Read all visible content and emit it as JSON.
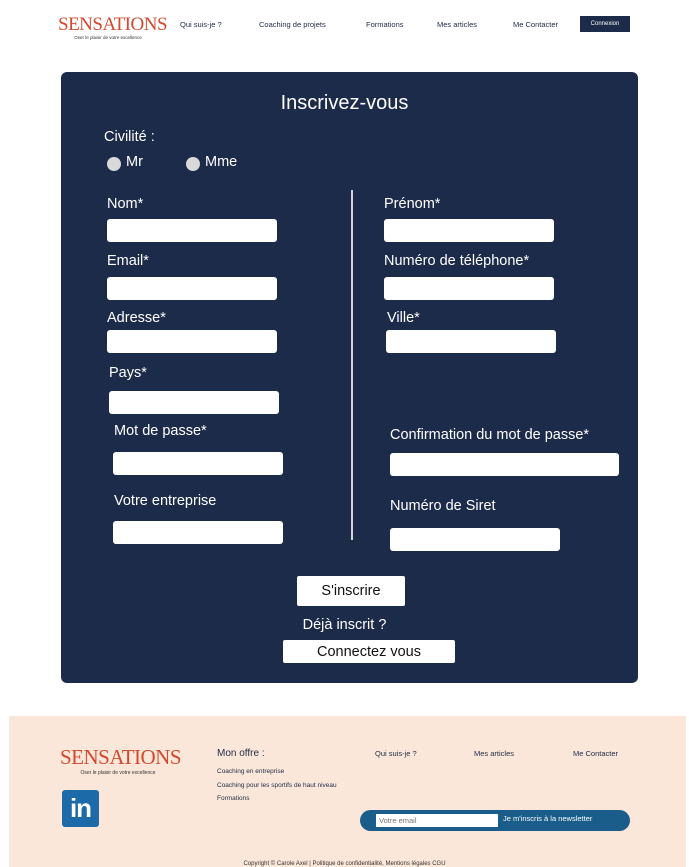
{
  "header": {
    "logo_word": "SENSATIONS",
    "logo_tagline": "Oser le plaisir de votre excellence",
    "nav": [
      "Qui suis-je ?",
      "Coaching de projets",
      "Formations",
      "Mes articles",
      "Me Contacter"
    ],
    "connexion_label": "Connexion"
  },
  "form": {
    "title": "Inscrivez-vous",
    "civility_label": "Civilité :",
    "civility_options": [
      "Mr",
      "Mme"
    ],
    "fields": {
      "nom": "Nom*",
      "prenom": "Prénom*",
      "email": "Email*",
      "telephone": "Numéro de téléphone*",
      "adresse": "Adresse*",
      "ville": "Ville*",
      "pays": "Pays*",
      "mot_de_passe": "Mot de passe*",
      "confirmation": "Confirmation du mot de passe*",
      "entreprise": "Votre entreprise",
      "siret": "Numéro de Siret"
    },
    "submit_label": "S'inscrire",
    "already_label": "Déjà inscrit ?",
    "login_label": "Connectez vous"
  },
  "footer": {
    "logo_word": "SENSATIONS",
    "logo_tagline": "Oser le plaisir de votre excellence",
    "offer_title": "Mon offre :",
    "offer_items": [
      "Coaching en entreprise",
      "Coaching pour les sportifs de haut niveau",
      "Formations"
    ],
    "links": [
      "Qui suis-je ?",
      "Mes articles",
      "Me Contacter"
    ],
    "newsletter_placeholder": "Votre email",
    "newsletter_button": "Je m'inscris à la newsletter",
    "linkedin_label": "in",
    "copyright": "Copyright © Carole Axel | Politique de confidentialité, Mentions légales CGU"
  },
  "colors": {
    "navy": "#1c2b49",
    "brand_orange": "#d2492d",
    "footer_bg": "#fbe7d9",
    "linkedin_blue": "#1d6aa9"
  }
}
